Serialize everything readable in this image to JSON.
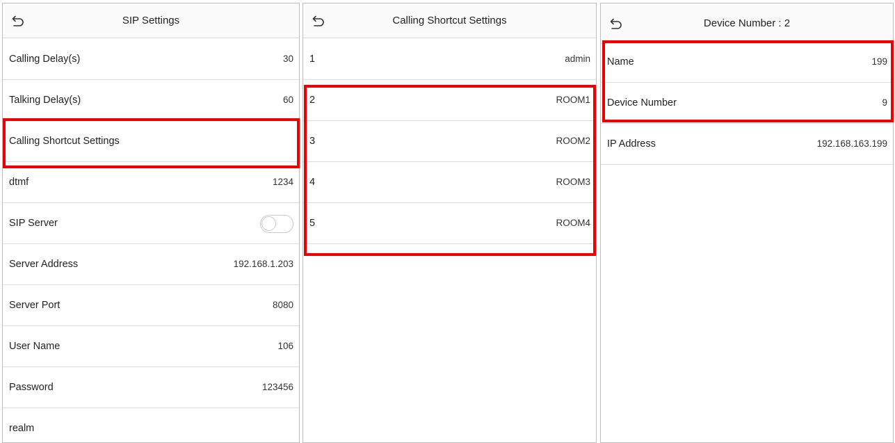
{
  "sip_settings": {
    "title": "SIP Settings",
    "rows": [
      {
        "label": "Calling Delay(s)",
        "value": "30"
      },
      {
        "label": "Talking Delay(s)",
        "value": "60"
      },
      {
        "label": "Calling Shortcut Settings",
        "value": ""
      },
      {
        "label": "dtmf",
        "value": "1234"
      },
      {
        "label": "SIP Server",
        "value": "",
        "toggle": "off"
      },
      {
        "label": "Server Address",
        "value": "192.168.1.203"
      },
      {
        "label": "Server Port",
        "value": "8080"
      },
      {
        "label": "User Name",
        "value": "106"
      },
      {
        "label": "Password",
        "value": "123456"
      },
      {
        "label": "realm",
        "value": ""
      }
    ]
  },
  "calling_shortcut_settings": {
    "title": "Calling Shortcut Settings",
    "rows": [
      {
        "label": "1",
        "value": "admin"
      },
      {
        "label": "2",
        "value": "ROOM1"
      },
      {
        "label": "3",
        "value": "ROOM2"
      },
      {
        "label": "4",
        "value": "ROOM3"
      },
      {
        "label": "5",
        "value": "ROOM4"
      }
    ]
  },
  "device_number": {
    "title": "Device Number : 2",
    "rows": [
      {
        "label": "Name",
        "value": "199"
      },
      {
        "label": "Device Number",
        "value": "9"
      },
      {
        "label": "IP Address",
        "value": "192.168.163.199"
      }
    ]
  },
  "colors": {
    "highlight": "#ee0000",
    "divider": "#dcdcdc",
    "text": "#222222"
  },
  "icons": {
    "back": "back-arrow-icon"
  }
}
